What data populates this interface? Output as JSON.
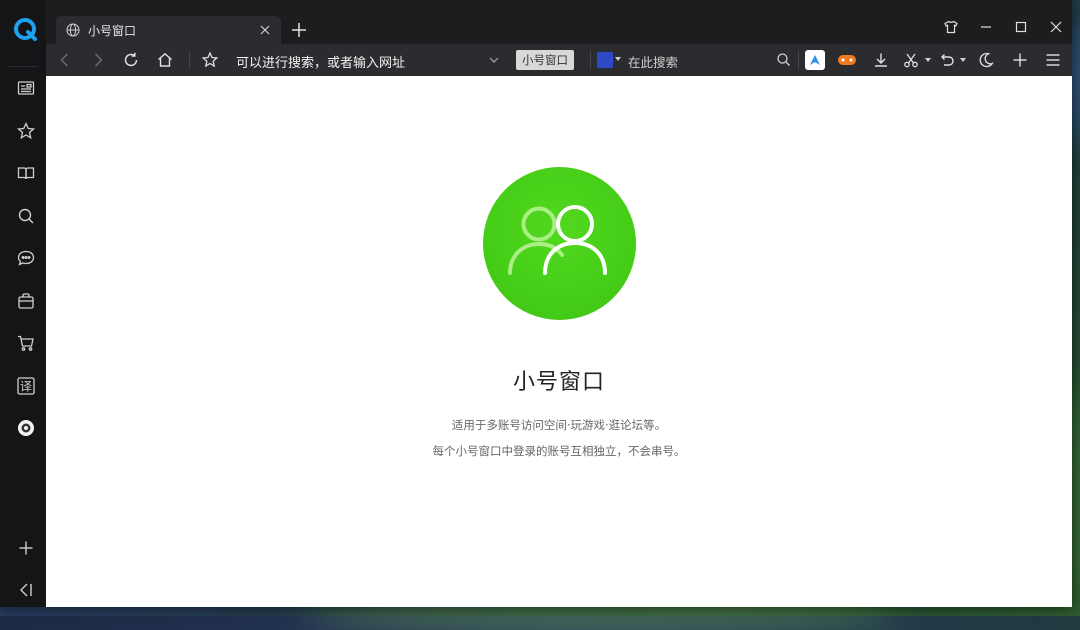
{
  "tab": {
    "title": "小号窗口"
  },
  "address_bar": {
    "text": "可以进行搜索，或者输入网址"
  },
  "toolbar": {
    "account_button_label": "小号窗口"
  },
  "search_bar": {
    "placeholder": "在此搜索"
  },
  "page": {
    "title": "小号窗口",
    "description_line1": "适用于多账号访问空间·玩游戏·逛论坛等。",
    "description_line2": "每个小号窗口中登录的账号互相独立，不会串号。"
  },
  "sidebar": {
    "items": [
      {
        "icon": "news-icon"
      },
      {
        "icon": "star-icon"
      },
      {
        "icon": "book-icon"
      },
      {
        "icon": "search-icon"
      },
      {
        "icon": "chat-icon"
      },
      {
        "icon": "bag-icon"
      },
      {
        "icon": "cart-icon"
      },
      {
        "icon": "translate-icon",
        "glyph": "译"
      },
      {
        "icon": "camera-icon"
      }
    ]
  },
  "colors": {
    "brand_green": "#45cd18",
    "sidebar_bg": "#141517",
    "toolbar_bg": "#2b2c2f"
  }
}
